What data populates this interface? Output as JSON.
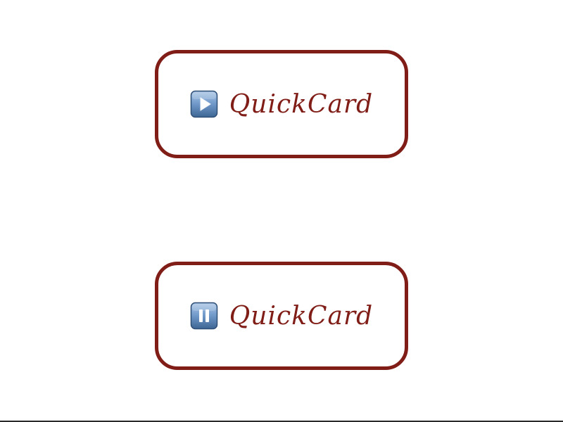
{
  "buttons": [
    {
      "state": "play",
      "label": "QuickCard",
      "icon": "play-icon"
    },
    {
      "state": "pause",
      "label": "QuickCard",
      "icon": "pause-icon"
    }
  ],
  "colors": {
    "accent": "#7f1d16",
    "icon_blue": "#5e86b6",
    "background": "#ffffff"
  }
}
